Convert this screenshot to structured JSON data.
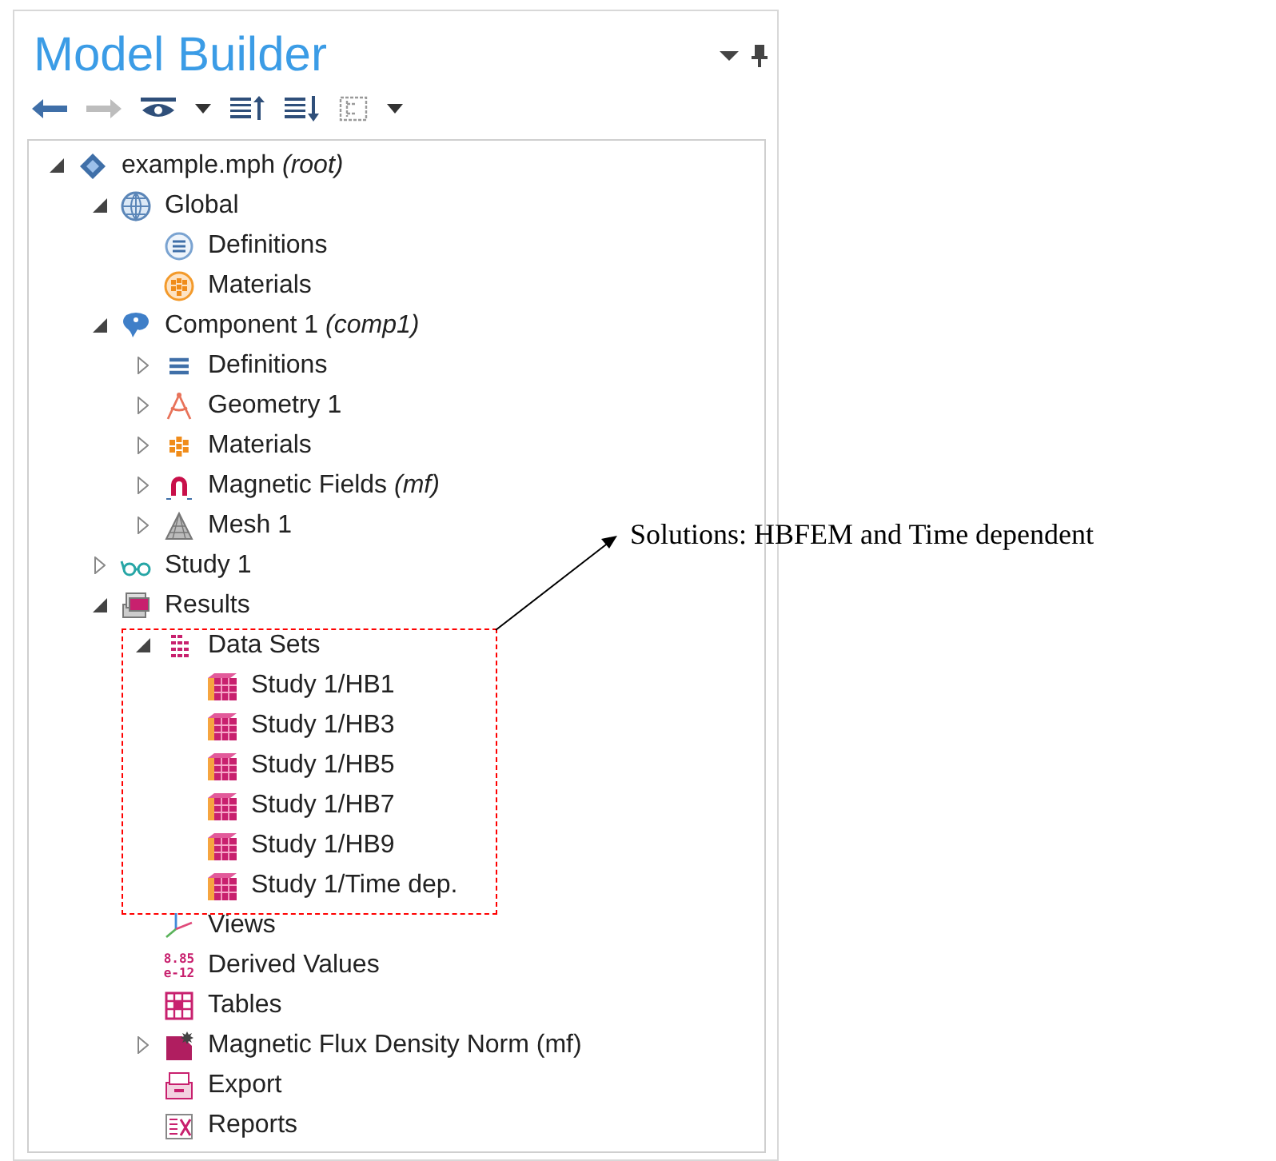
{
  "panel": {
    "title": "Model Builder"
  },
  "annotation": {
    "text": "Solutions: HBFEM and Time dependent"
  },
  "tree": [
    {
      "label": "example.mph *(root)*",
      "kind": "root",
      "expanded": true,
      "children": [
        {
          "label": "Global",
          "kind": "globe",
          "expanded": true,
          "children": [
            {
              "label": "Definitions",
              "kind": "definitions-circle"
            },
            {
              "label": "Materials",
              "kind": "materials-circle"
            }
          ]
        },
        {
          "label": "Component 1 *(comp1)*",
          "kind": "component",
          "expanded": true,
          "children": [
            {
              "label": "Definitions",
              "kind": "definitions",
              "expanded": false
            },
            {
              "label": "Geometry 1",
              "kind": "geometry",
              "expanded": false
            },
            {
              "label": "Materials",
              "kind": "materials",
              "expanded": false
            },
            {
              "label": "Magnetic Fields *(mf)*",
              "kind": "magnet",
              "expanded": false
            },
            {
              "label": "Mesh 1",
              "kind": "mesh",
              "expanded": false
            }
          ]
        },
        {
          "label": "Study 1",
          "kind": "study",
          "expanded": false
        },
        {
          "label": "Results",
          "kind": "results",
          "expanded": true,
          "children": [
            {
              "label": "Data Sets",
              "kind": "datasets",
              "expanded": true,
              "children": [
                {
                  "label": "Study 1/HB1",
                  "kind": "solution"
                },
                {
                  "label": "Study 1/HB3",
                  "kind": "solution"
                },
                {
                  "label": "Study 1/HB5",
                  "kind": "solution"
                },
                {
                  "label": "Study 1/HB7",
                  "kind": "solution"
                },
                {
                  "label": "Study 1/HB9",
                  "kind": "solution"
                },
                {
                  "label": "Study 1/Time dep.",
                  "kind": "solution"
                }
              ]
            },
            {
              "label": "Views",
              "kind": "views"
            },
            {
              "label": "Derived Values",
              "kind": "derived",
              "icon_text": [
                "8.85",
                "e-12"
              ]
            },
            {
              "label": "Tables",
              "kind": "tables"
            },
            {
              "label": "Magnetic Flux Density Norm (mf)",
              "kind": "plot",
              "expanded": false
            },
            {
              "label": "Export",
              "kind": "export"
            },
            {
              "label": "Reports",
              "kind": "reports"
            }
          ]
        }
      ]
    }
  ]
}
